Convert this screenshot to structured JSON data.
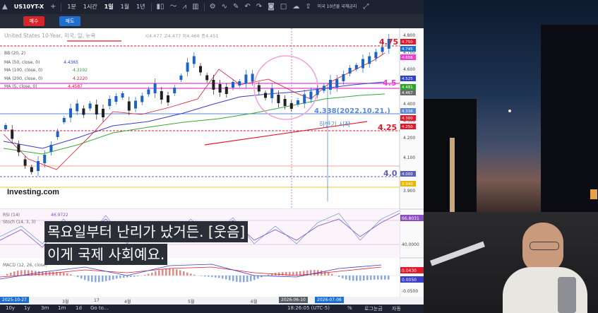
{
  "toolbar": {
    "symbol": "US10YT-X",
    "intervals": [
      "1분",
      "1시간",
      "1일",
      "1월",
      "1년"
    ],
    "indicator_search": "미국 10년물 국채금리"
  },
  "order_buttons": {
    "buy": "매수",
    "sell": "매도"
  },
  "chart": {
    "title": "United States 10-Year, 미국, 일, 뉴욕",
    "ohlc": "시4.477 고4.477 저4.468 종4.451",
    "indicators": [
      {
        "label": "BB (20, 2)",
        "value": ""
      },
      {
        "label": "MA (50, close, 0)",
        "value": "4.4365"
      },
      {
        "label": "MA (100, close, 0)",
        "value": "4.3192"
      },
      {
        "label": "MA (200, close, 0)",
        "value": "4.2220"
      },
      {
        "label": "MA (5, close, 0)",
        "value": "4.4587"
      }
    ],
    "y_ticks": [
      "4.800",
      "4.700",
      "4.600",
      "4.500",
      "4.400",
      "4.300",
      "4.200",
      "4.100",
      "4.000",
      "3.900"
    ],
    "price_tags": [
      {
        "text": "4.750",
        "color": "#e0192b"
      },
      {
        "text": "4.745",
        "color": "#1f6fd1"
      },
      {
        "text": "4.656",
        "color": "#e83fd0"
      },
      {
        "text": "4.525",
        "color": "#2d43c9"
      },
      {
        "text": "4.481",
        "color": "#2aa52a"
      },
      {
        "text": "4.467",
        "color": "#6b6b6b"
      },
      {
        "text": "4.338",
        "color": "#5b8ad6"
      },
      {
        "text": "4.300",
        "color": "#e0192b"
      },
      {
        "text": "4.250",
        "color": "#e0192b"
      },
      {
        "text": "4.000",
        "color": "#5b5fb8"
      },
      {
        "text": "3.949",
        "color": "#e8b800"
      }
    ],
    "annotations": {
      "level_475": "4.75",
      "level_45": "4.5",
      "level_425": "4.25",
      "level_40": "4.0",
      "point_label": "4.338(2022.10.21.)",
      "second_half": "하반기 시작"
    },
    "watermark": "Investing.com",
    "rsi": {
      "label": "RSI (14)",
      "value": "46.9722",
      "stoch_label": "Stoch (14, 3, 3)",
      "tag_top": "66.8031",
      "tag_mid": "40.0000"
    },
    "macd": {
      "label": "MACD (12, 26, close)",
      "tag1": "0.0430",
      "tag2": "0.0050",
      "tag3": "-0.0500"
    },
    "x_labels": [
      "3월",
      "17",
      "4월",
      "5월",
      "6월"
    ],
    "date_tags": {
      "left": "2025-10-27",
      "mid1": "2026-06-10",
      "mid2": "2026-07-06"
    }
  },
  "bottombar": {
    "ranges": [
      "10y",
      "1y",
      "3m",
      "1m",
      "1d",
      "Go to..."
    ],
    "time": "18:26:05 (UTC-5)",
    "pct": "%",
    "log": "로그눈금",
    "auto": "자동"
  },
  "subtitle": {
    "line1": "목요일부터 난리가 났거든. [웃음]",
    "line2": "이게 국제 사회예요."
  }
}
